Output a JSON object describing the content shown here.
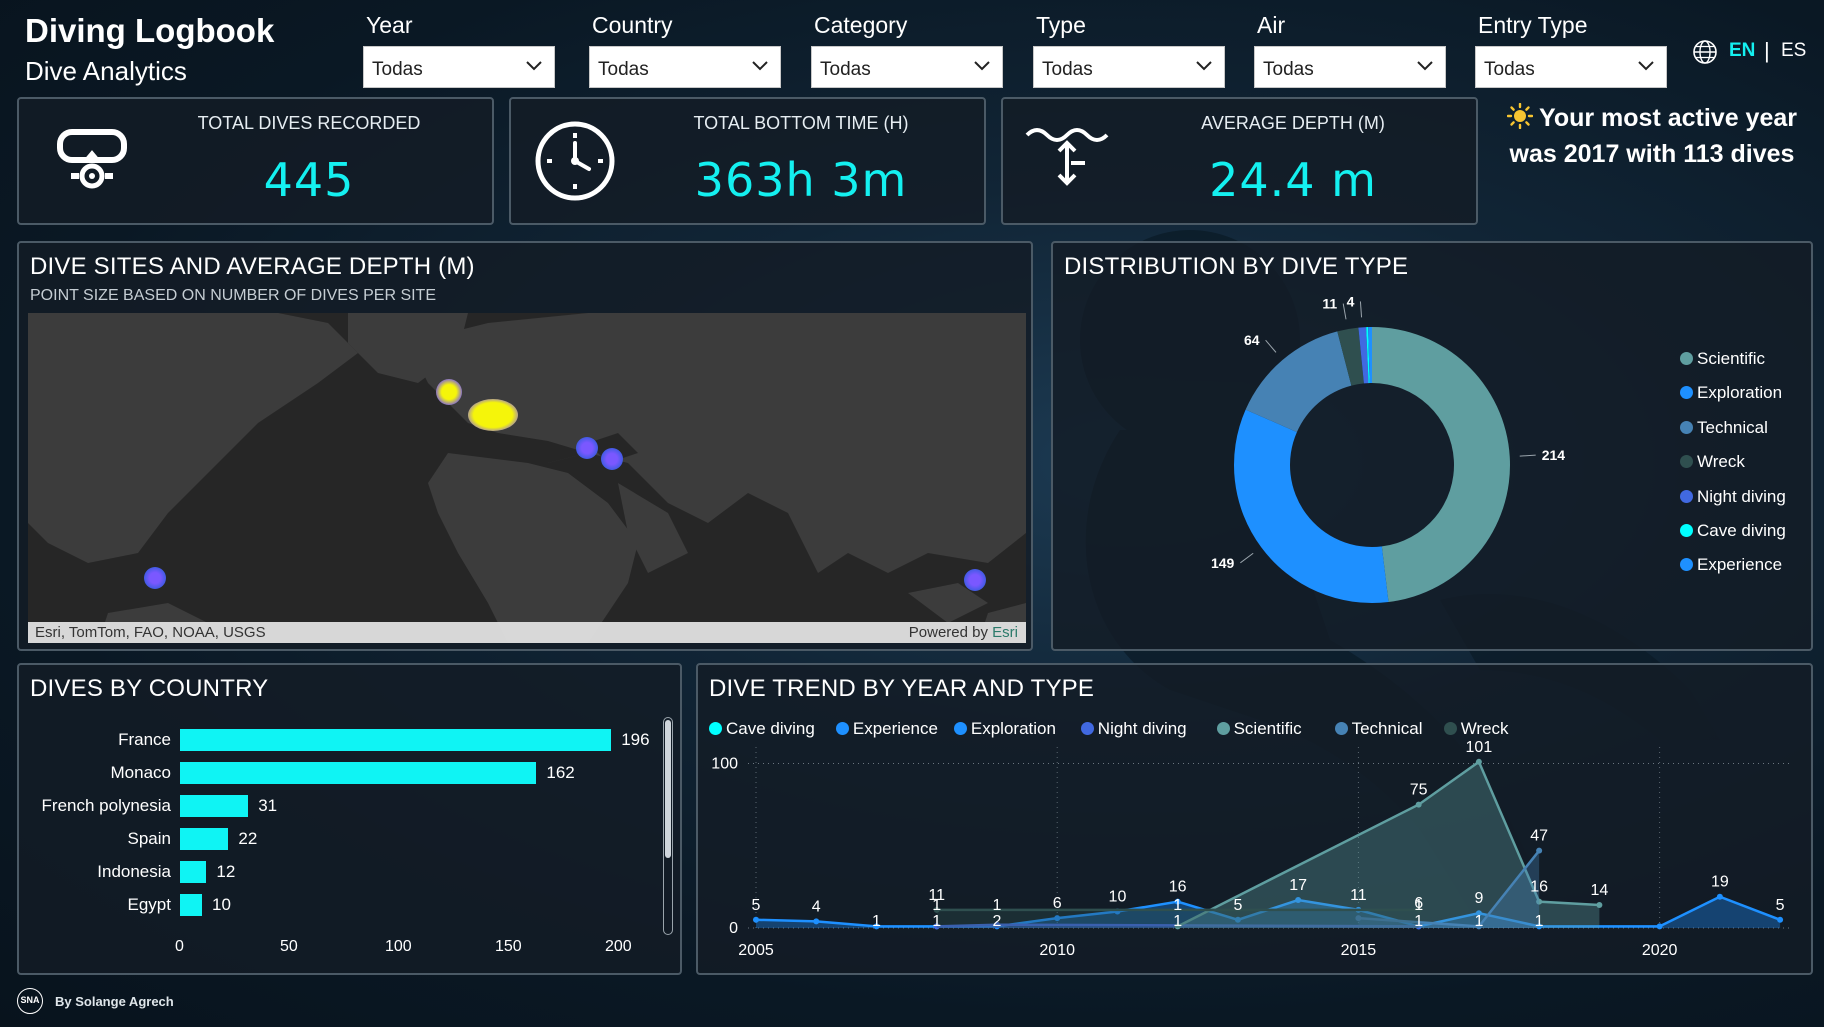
{
  "header": {
    "title": "Diving Logbook",
    "subtitle": "Dive Analytics",
    "lang_en": "EN",
    "lang_sep": "|",
    "lang_es": "ES"
  },
  "filters": [
    {
      "label": "Year",
      "value": "Todas"
    },
    {
      "label": "Country",
      "value": "Todas"
    },
    {
      "label": "Category",
      "value": "Todas"
    },
    {
      "label": "Type",
      "value": "Todas"
    },
    {
      "label": "Air",
      "value": "Todas"
    },
    {
      "label": "Entry Type",
      "value": "Todas"
    }
  ],
  "kpis": [
    {
      "label": "TOTAL DIVES RECORDED",
      "value": "445",
      "icon": "diving-mask-icon"
    },
    {
      "label": "TOTAL BOTTOM TIME (H)",
      "value": "363h 3m",
      "icon": "clock-icon"
    },
    {
      "label": "AVERAGE DEPTH (M)",
      "value": "24.4 m",
      "icon": "depth-arrow-icon"
    }
  ],
  "highlight": {
    "icon": "sun-icon",
    "text": "Your most active year was 2017 with 113 dives"
  },
  "map": {
    "title": "DIVE SITES AND AVERAGE DEPTH (M)",
    "subtitle": "POINT SIZE BASED ON NUMBER OF DIVES PER SITE",
    "attribution": "Esri, TomTom, FAO, NOAA, USGS",
    "powered_prefix": "Powered by ",
    "powered_brand": "Esri"
  },
  "colors": {
    "accent": "#0ff4f4",
    "scientific": "#5f9ea0",
    "exploration": "#1e90ff",
    "technical": "#4682b4",
    "wreck": "#2f4f4f",
    "night_diving": "#4169e1",
    "cave_diving": "#00ffff",
    "experience": "#1e90ff"
  },
  "chart_data": [
    {
      "type": "pie",
      "title": "DISTRIBUTION BY DIVE TYPE",
      "legend_position": "right",
      "slices": [
        {
          "name": "Scientific",
          "value": 214,
          "color": "#5f9ea0"
        },
        {
          "name": "Exploration",
          "value": 149,
          "color": "#1e90ff"
        },
        {
          "name": "Technical",
          "value": 64,
          "color": "#4682b4"
        },
        {
          "name": "Wreck",
          "value": 11,
          "color": "#2f4f4f"
        },
        {
          "name": "Night diving",
          "value": 4,
          "color": "#4169e1"
        },
        {
          "name": "Cave diving",
          "value": 1,
          "color": "#00ffff"
        },
        {
          "name": "Experience",
          "value": 2,
          "color": "#1e90ff"
        }
      ],
      "data_labels": [
        "214",
        "149",
        "64",
        "11",
        "4"
      ]
    },
    {
      "type": "bar",
      "title": "DIVES BY COUNTRY",
      "orientation": "horizontal",
      "categories": [
        "France",
        "Monaco",
        "French polynesia",
        "Spain",
        "Indonesia",
        "Egypt"
      ],
      "values": [
        196,
        162,
        31,
        22,
        12,
        10
      ],
      "xlim": [
        0,
        210
      ],
      "xticks": [
        "0",
        "50",
        "100",
        "150",
        "200"
      ]
    },
    {
      "type": "area",
      "title": "DIVE TREND BY YEAR AND TYPE",
      "legend_position": "top-left",
      "xlim": [
        2005,
        2022
      ],
      "ylim": [
        0,
        110
      ],
      "xticks": [
        "2005",
        "2010",
        "2015",
        "2020"
      ],
      "yticks": [
        "0",
        "100"
      ],
      "series": [
        {
          "name": "Cave diving",
          "color": "#00ffff",
          "points": []
        },
        {
          "name": "Experience",
          "color": "#1e90ff",
          "points": []
        },
        {
          "name": "Exploration",
          "color": "#1e90ff",
          "points": [
            [
              2005,
              5
            ],
            [
              2006,
              4
            ],
            [
              2007,
              1
            ],
            [
              2008,
              1
            ],
            [
              2009,
              1
            ],
            [
              2010,
              6
            ],
            [
              2011,
              10
            ],
            [
              2012,
              16
            ],
            [
              2013,
              5
            ],
            [
              2014,
              17
            ],
            [
              2015,
              11
            ],
            [
              2016,
              1
            ],
            [
              2017,
              9
            ],
            [
              2018,
              1
            ],
            [
              2020,
              1
            ],
            [
              2021,
              19
            ],
            [
              2022,
              5
            ]
          ]
        },
        {
          "name": "Night diving",
          "color": "#4169e1",
          "points": [
            [
              2008,
              1
            ],
            [
              2009,
              2
            ],
            [
              2016,
              1
            ]
          ]
        },
        {
          "name": "Scientific",
          "color": "#5f9ea0",
          "points": [
            [
              2012,
              1
            ],
            [
              2016,
              75
            ],
            [
              2017,
              101
            ],
            [
              2018,
              16
            ],
            [
              2019,
              14
            ]
          ]
        },
        {
          "name": "Technical",
          "color": "#4682b4",
          "points": [
            [
              2015,
              6
            ],
            [
              2017,
              1
            ],
            [
              2018,
              47
            ]
          ]
        },
        {
          "name": "Wreck",
          "color": "#2f4f4f",
          "points": [
            [
              2008,
              11
            ],
            [
              2016,
              11
            ]
          ]
        }
      ],
      "data_labels": [
        {
          "x": 2005,
          "y": 5,
          "text": "5"
        },
        {
          "x": 2006,
          "y": 4,
          "text": "4"
        },
        {
          "x": 2007,
          "y": 1,
          "text": "1"
        },
        {
          "x": 2008,
          "y": 1,
          "text": "1"
        },
        {
          "x": 2008,
          "y": 11,
          "text": "11"
        },
        {
          "x": 2008,
          "y": 1,
          "text": "1"
        },
        {
          "x": 2009,
          "y": 2,
          "text": "2"
        },
        {
          "x": 2009,
          "y": 1,
          "text": "1"
        },
        {
          "x": 2010,
          "y": 6,
          "text": "6"
        },
        {
          "x": 2011,
          "y": 10,
          "text": "10"
        },
        {
          "x": 2012,
          "y": 16,
          "text": "16"
        },
        {
          "x": 2012,
          "y": 1,
          "text": "1"
        },
        {
          "x": 2012,
          "y": 1,
          "text": "1"
        },
        {
          "x": 2013,
          "y": 5,
          "text": "5"
        },
        {
          "x": 2014,
          "y": 17,
          "text": "17"
        },
        {
          "x": 2015,
          "y": 11,
          "text": "11"
        },
        {
          "x": 2016,
          "y": 75,
          "text": "75"
        },
        {
          "x": 2016,
          "y": 1,
          "text": "1"
        },
        {
          "x": 2016,
          "y": 1,
          "text": "1"
        },
        {
          "x": 2016,
          "y": 6,
          "text": "6"
        },
        {
          "x": 2017,
          "y": 101,
          "text": "101"
        },
        {
          "x": 2017,
          "y": 9,
          "text": "9"
        },
        {
          "x": 2017,
          "y": 1,
          "text": "1"
        },
        {
          "x": 2018,
          "y": 47,
          "text": "47"
        },
        {
          "x": 2018,
          "y": 16,
          "text": "16"
        },
        {
          "x": 2018,
          "y": 1,
          "text": "1"
        },
        {
          "x": 2019,
          "y": 14,
          "text": "14"
        },
        {
          "x": 2021,
          "y": 19,
          "text": "19"
        },
        {
          "x": 2022,
          "y": 5,
          "text": "5"
        }
      ]
    }
  ],
  "footer": {
    "logo_text": "SNA",
    "author": "By Solange Agrech"
  }
}
